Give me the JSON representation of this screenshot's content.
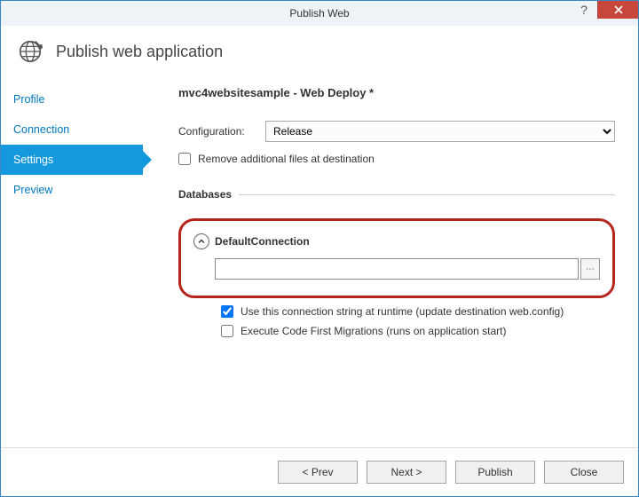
{
  "titlebar": {
    "title": "Publish Web"
  },
  "header": {
    "title": "Publish web application"
  },
  "sidebar": {
    "items": [
      {
        "label": "Profile"
      },
      {
        "label": "Connection"
      },
      {
        "label": "Settings"
      },
      {
        "label": "Preview"
      }
    ]
  },
  "main": {
    "page_title": "mvc4websitesample - Web Deploy *",
    "config_label": "Configuration:",
    "config_value": "Release",
    "remove_files_label": "Remove additional files at destination",
    "databases_label": "Databases",
    "connection": {
      "name": "DefaultConnection",
      "value": "",
      "use_runtime_label": "Use this connection string at runtime (update destination web.config)",
      "code_first_label": "Execute Code First Migrations (runs on application start)"
    }
  },
  "footer": {
    "prev": "< Prev",
    "next": "Next >",
    "publish": "Publish",
    "close": "Close"
  }
}
